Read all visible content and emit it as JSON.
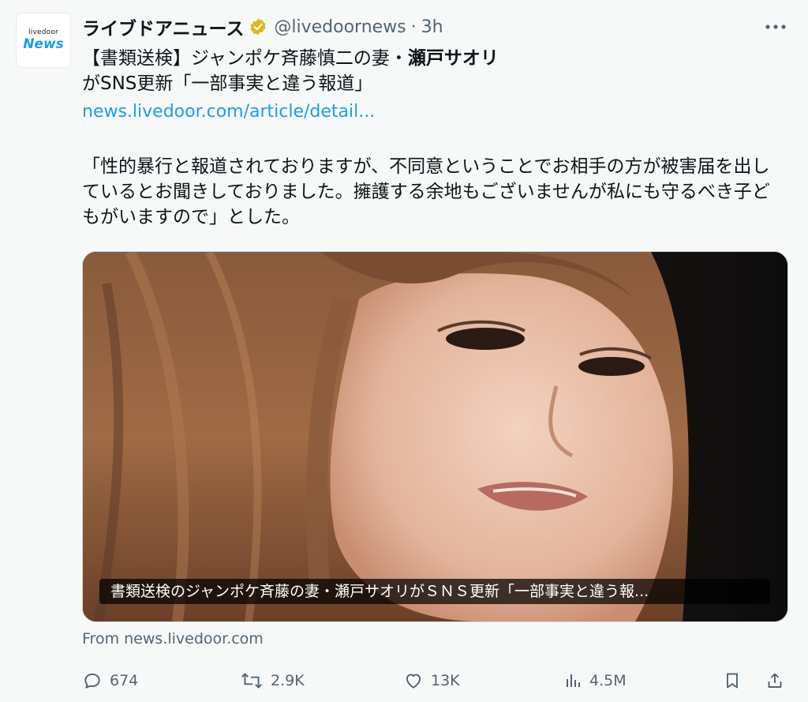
{
  "account": {
    "avatar_small": "livedoor",
    "avatar_big": "News",
    "display_name": "ライブドアニュース",
    "handle": "@livedoornews",
    "separator": "·",
    "time": "3h"
  },
  "post": {
    "headline_prefix": "【書類送検】ジャンポケ斉藤慎二の妻・",
    "headline_bold": "瀬戸サオリ",
    "headline_suffix": "がSNS更新「一部事実と違う報道」",
    "link": "news.livedoor.com/article/detail...",
    "quote": "「性的暴行と報道されておりますが、不同意ということでお相手の方が被害届を出しているとお聞きしておりました。擁護する余地もございませんが私にも守るべき子どもがいますので」とした。"
  },
  "media": {
    "caption": "書類送検のジャンポケ斉藤の妻・瀬戸サオリがＳＮＳ更新「一部事実と違う報..."
  },
  "card_source": "From news.livedoor.com",
  "metrics": {
    "replies": "674",
    "reposts": "2.9K",
    "likes": "13K",
    "views": "4.5M"
  },
  "icons": {
    "verified": "verified-gold-badge-icon",
    "more": "more-dots-icon",
    "reply": "reply-icon",
    "repost": "repost-icon",
    "like": "heart-icon",
    "views": "views-chart-icon",
    "bookmark": "bookmark-icon",
    "share": "share-icon"
  },
  "colors": {
    "link": "#1d9bf0",
    "muted": "#536471",
    "verified": "#e2b719",
    "background": "#f7f9f9"
  }
}
